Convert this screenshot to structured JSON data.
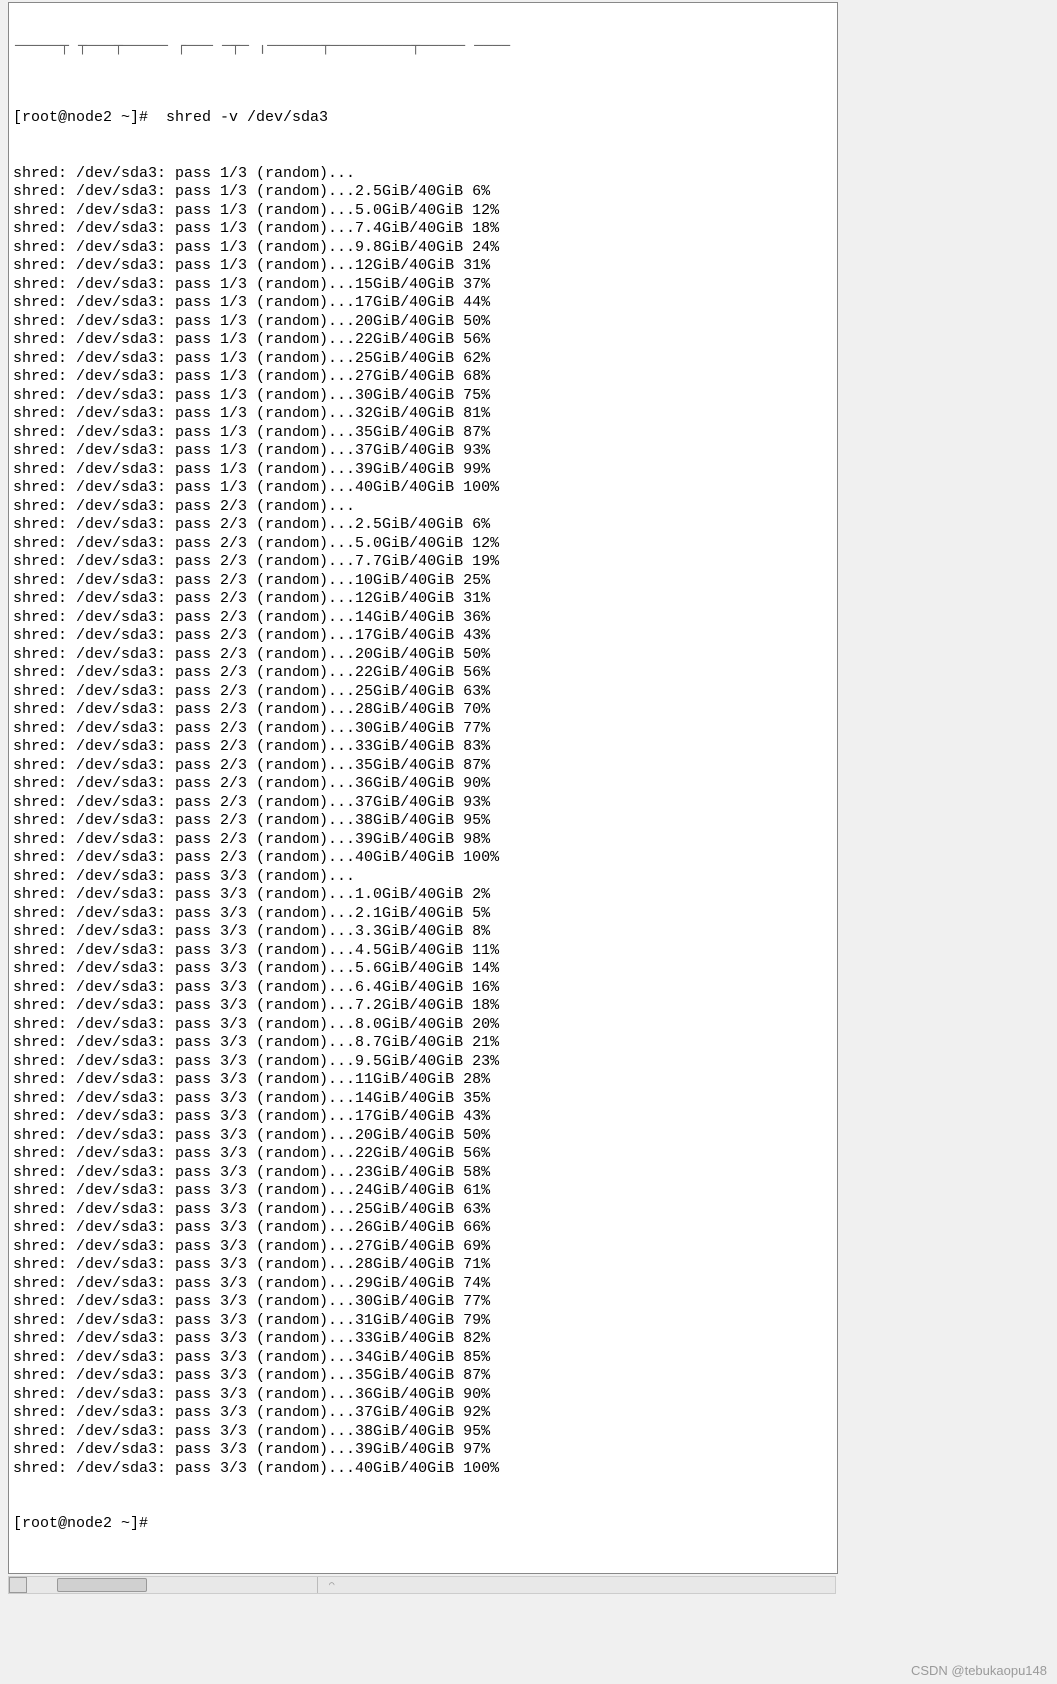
{
  "terminal": {
    "truncated_top_command": "[root@node2 ~]#  shred -v /dev/sda3",
    "device": "/dev/sda3",
    "prompt_end": "[root@node2 ~]# ",
    "lines": [
      "shred: /dev/sda3: pass 1/3 (random)...",
      "shred: /dev/sda3: pass 1/3 (random)...2.5GiB/40GiB 6%",
      "shred: /dev/sda3: pass 1/3 (random)...5.0GiB/40GiB 12%",
      "shred: /dev/sda3: pass 1/3 (random)...7.4GiB/40GiB 18%",
      "shred: /dev/sda3: pass 1/3 (random)...9.8GiB/40GiB 24%",
      "shred: /dev/sda3: pass 1/3 (random)...12GiB/40GiB 31%",
      "shred: /dev/sda3: pass 1/3 (random)...15GiB/40GiB 37%",
      "shred: /dev/sda3: pass 1/3 (random)...17GiB/40GiB 44%",
      "shred: /dev/sda3: pass 1/3 (random)...20GiB/40GiB 50%",
      "shred: /dev/sda3: pass 1/3 (random)...22GiB/40GiB 56%",
      "shred: /dev/sda3: pass 1/3 (random)...25GiB/40GiB 62%",
      "shred: /dev/sda3: pass 1/3 (random)...27GiB/40GiB 68%",
      "shred: /dev/sda3: pass 1/3 (random)...30GiB/40GiB 75%",
      "shred: /dev/sda3: pass 1/3 (random)...32GiB/40GiB 81%",
      "shred: /dev/sda3: pass 1/3 (random)...35GiB/40GiB 87%",
      "shred: /dev/sda3: pass 1/3 (random)...37GiB/40GiB 93%",
      "shred: /dev/sda3: pass 1/3 (random)...39GiB/40GiB 99%",
      "shred: /dev/sda3: pass 1/3 (random)...40GiB/40GiB 100%",
      "shred: /dev/sda3: pass 2/3 (random)...",
      "shred: /dev/sda3: pass 2/3 (random)...2.5GiB/40GiB 6%",
      "shred: /dev/sda3: pass 2/3 (random)...5.0GiB/40GiB 12%",
      "shred: /dev/sda3: pass 2/3 (random)...7.7GiB/40GiB 19%",
      "shred: /dev/sda3: pass 2/3 (random)...10GiB/40GiB 25%",
      "shred: /dev/sda3: pass 2/3 (random)...12GiB/40GiB 31%",
      "shred: /dev/sda3: pass 2/3 (random)...14GiB/40GiB 36%",
      "shred: /dev/sda3: pass 2/3 (random)...17GiB/40GiB 43%",
      "shred: /dev/sda3: pass 2/3 (random)...20GiB/40GiB 50%",
      "shred: /dev/sda3: pass 2/3 (random)...22GiB/40GiB 56%",
      "shred: /dev/sda3: pass 2/3 (random)...25GiB/40GiB 63%",
      "shred: /dev/sda3: pass 2/3 (random)...28GiB/40GiB 70%",
      "shred: /dev/sda3: pass 2/3 (random)...30GiB/40GiB 77%",
      "shred: /dev/sda3: pass 2/3 (random)...33GiB/40GiB 83%",
      "shred: /dev/sda3: pass 2/3 (random)...35GiB/40GiB 87%",
      "shred: /dev/sda3: pass 2/3 (random)...36GiB/40GiB 90%",
      "shred: /dev/sda3: pass 2/3 (random)...37GiB/40GiB 93%",
      "shred: /dev/sda3: pass 2/3 (random)...38GiB/40GiB 95%",
      "shred: /dev/sda3: pass 2/3 (random)...39GiB/40GiB 98%",
      "shred: /dev/sda3: pass 2/3 (random)...40GiB/40GiB 100%",
      "shred: /dev/sda3: pass 3/3 (random)...",
      "shred: /dev/sda3: pass 3/3 (random)...1.0GiB/40GiB 2%",
      "shred: /dev/sda3: pass 3/3 (random)...2.1GiB/40GiB 5%",
      "shred: /dev/sda3: pass 3/3 (random)...3.3GiB/40GiB 8%",
      "shred: /dev/sda3: pass 3/3 (random)...4.5GiB/40GiB 11%",
      "shred: /dev/sda3: pass 3/3 (random)...5.6GiB/40GiB 14%",
      "shred: /dev/sda3: pass 3/3 (random)...6.4GiB/40GiB 16%",
      "shred: /dev/sda3: pass 3/3 (random)...7.2GiB/40GiB 18%",
      "shred: /dev/sda3: pass 3/3 (random)...8.0GiB/40GiB 20%",
      "shred: /dev/sda3: pass 3/3 (random)...8.7GiB/40GiB 21%",
      "shred: /dev/sda3: pass 3/3 (random)...9.5GiB/40GiB 23%",
      "shred: /dev/sda3: pass 3/3 (random)...11GiB/40GiB 28%",
      "shred: /dev/sda3: pass 3/3 (random)...14GiB/40GiB 35%",
      "shred: /dev/sda3: pass 3/3 (random)...17GiB/40GiB 43%",
      "shred: /dev/sda3: pass 3/3 (random)...20GiB/40GiB 50%",
      "shred: /dev/sda3: pass 3/3 (random)...22GiB/40GiB 56%",
      "shred: /dev/sda3: pass 3/3 (random)...23GiB/40GiB 58%",
      "shred: /dev/sda3: pass 3/3 (random)...24GiB/40GiB 61%",
      "shred: /dev/sda3: pass 3/3 (random)...25GiB/40GiB 63%",
      "shred: /dev/sda3: pass 3/3 (random)...26GiB/40GiB 66%",
      "shred: /dev/sda3: pass 3/3 (random)...27GiB/40GiB 69%",
      "shred: /dev/sda3: pass 3/3 (random)...28GiB/40GiB 71%",
      "shred: /dev/sda3: pass 3/3 (random)...29GiB/40GiB 74%",
      "shred: /dev/sda3: pass 3/3 (random)...30GiB/40GiB 77%",
      "shred: /dev/sda3: pass 3/3 (random)...31GiB/40GiB 79%",
      "shred: /dev/sda3: pass 3/3 (random)...33GiB/40GiB 82%",
      "shred: /dev/sda3: pass 3/3 (random)...34GiB/40GiB 85%",
      "shred: /dev/sda3: pass 3/3 (random)...35GiB/40GiB 87%",
      "shred: /dev/sda3: pass 3/3 (random)...36GiB/40GiB 90%",
      "shred: /dev/sda3: pass 3/3 (random)...37GiB/40GiB 92%",
      "shred: /dev/sda3: pass 3/3 (random)...38GiB/40GiB 95%",
      "shred: /dev/sda3: pass 3/3 (random)...39GiB/40GiB 97%",
      "shred: /dev/sda3: pass 3/3 (random)...40GiB/40GiB 100%"
    ]
  },
  "watermark": "CSDN @tebukaopu148"
}
